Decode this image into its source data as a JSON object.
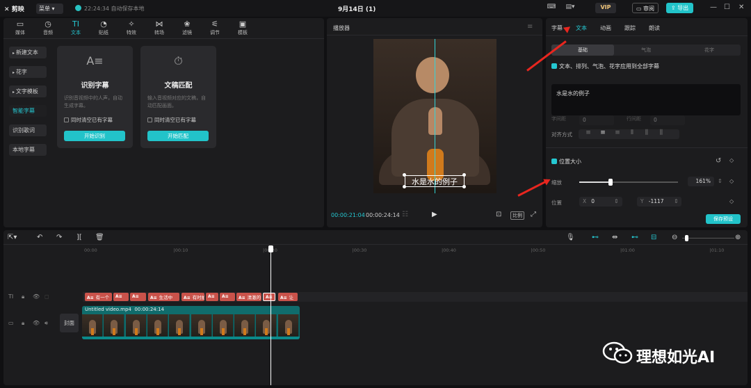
{
  "topbar": {
    "logo": "剪映",
    "menu": "菜单",
    "save_status": "22:24:34 自动保存本地",
    "title": "9月14日 (1)",
    "vip": "VIP",
    "share": "审阅",
    "export": "导出"
  },
  "tool_tabs": [
    {
      "icon": "media-icon",
      "glyph": "▭",
      "label": "媒体"
    },
    {
      "icon": "audio-icon",
      "glyph": "◷",
      "label": "音频"
    },
    {
      "icon": "text-icon",
      "glyph": "TI",
      "label": "文本"
    },
    {
      "icon": "sticker-icon",
      "glyph": "◔",
      "label": "贴纸"
    },
    {
      "icon": "effects-icon",
      "glyph": "✧",
      "label": "特效"
    },
    {
      "icon": "transition-icon",
      "glyph": "⋈",
      "label": "转场"
    },
    {
      "icon": "filter-icon",
      "glyph": "❀",
      "label": "滤镜"
    },
    {
      "icon": "adjust-icon",
      "glyph": "⚟",
      "label": "调节"
    },
    {
      "icon": "template-icon",
      "glyph": "▣",
      "label": "模板"
    }
  ],
  "sidebar": [
    {
      "label": "新建文本"
    },
    {
      "label": "花字"
    },
    {
      "label": "文字模板"
    },
    {
      "label": "智能字幕"
    },
    {
      "label": "识别歌词"
    },
    {
      "label": "本地字幕"
    }
  ],
  "cards": [
    {
      "title": "识别字幕",
      "desc": "识别音视频中的人声，自动生成字幕。",
      "check": "同时清空已有字幕",
      "button": "开始识别",
      "icon": "A≡"
    },
    {
      "title": "文稿匹配",
      "desc": "输入音视频对应的文稿，自动匹配画面。",
      "check": "同时清空已有字幕",
      "button": "开始匹配",
      "icon": "⏱"
    }
  ],
  "player": {
    "title": "播放器",
    "subtitle": "水是水的例子",
    "time_current": "00:00:21:04",
    "time_total": "00:00:24:14",
    "ratio": "比例"
  },
  "right": {
    "tabs": [
      "字幕",
      "文本",
      "动画",
      "跟踪",
      "朗读"
    ],
    "seg": [
      "基础",
      "气泡",
      "花字"
    ],
    "apply_all": "文本、排列、气泡、花字应用到全部字幕",
    "text_value": "水是水的例子",
    "spacing_labels": [
      "字间距",
      "行间距"
    ],
    "spacing_values": [
      "0",
      "0"
    ],
    "align_label": "对齐方式",
    "position_size": "位置大小",
    "scale_label": "缩放",
    "scale_value": "161%",
    "scale_fraction": 0.32,
    "pos_label": "位置",
    "x_label": "X",
    "x_value": "0",
    "y_label": "Y",
    "y_value": "-1117",
    "save_preset": "保存预设"
  },
  "timeline": {
    "ruler": [
      "00:00",
      "|00:10",
      "|00:20",
      "|00:30",
      "|00:40",
      "|00:50",
      "|01:00",
      "|01:10"
    ],
    "text_clips": [
      "有一个",
      "",
      "生活中",
      "有时拍",
      "",
      "清澈的",
      "",
      "让"
    ],
    "video_name": "Untitled video.mp4",
    "video_duration": "00:00:24:14",
    "cover": "封面"
  },
  "watermark": "理想如光AI",
  "colors": {
    "accent": "#22c3c9",
    "annotation_arrow": "#e8261f",
    "text_clip": "#c9524a"
  }
}
